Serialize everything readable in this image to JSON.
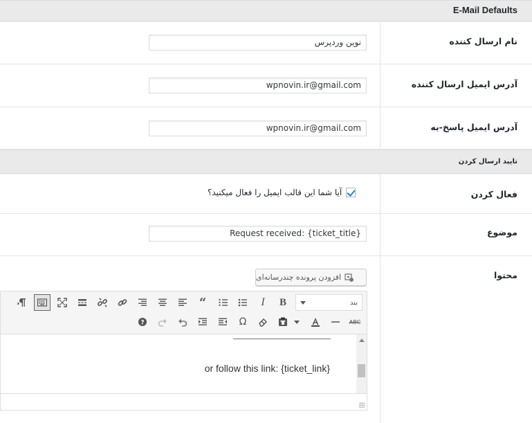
{
  "section1": {
    "title": "E-Mail Defaults"
  },
  "fields": {
    "sender_name": {
      "label": "نام ارسال کننده",
      "value": "نوین وردپرس"
    },
    "sender_email": {
      "label": "آدرس ایمیل ارسال کننده",
      "value": "wpnovin.ir@gmail.com"
    },
    "reply_email": {
      "label": "آدرس ایمیل پاسخ-به",
      "value": "wpnovin.ir@gmail.com"
    }
  },
  "section2": {
    "title": "تایید ارسال کردن"
  },
  "enable": {
    "label": "فعال کردن",
    "checkbox_label": "آیا شما این قالب ایمیل را فعال میکنید؟",
    "checked": true
  },
  "subject": {
    "label": "موضوع",
    "value": "Request received: {ticket_title}"
  },
  "content": {
    "label": "محتوا",
    "add_media": "افزودن پرونده چندرسانه‌ای",
    "format_select": "بند",
    "body_text": "or follow this link: {ticket_link}"
  },
  "colors": {
    "accent": "#1e8cbe",
    "border": "#dddddd",
    "header_bg": "#eaeaea"
  }
}
